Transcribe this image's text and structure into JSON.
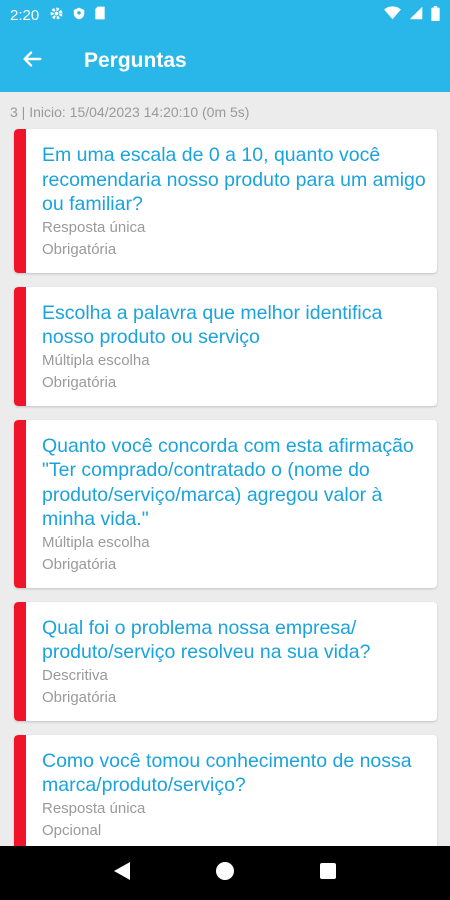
{
  "status_bar": {
    "time": "2:20",
    "icons_left": [
      "gear-icon",
      "shield-icon",
      "sd-card-icon"
    ],
    "icons_right": [
      "wifi-icon",
      "signal-icon",
      "battery-icon"
    ]
  },
  "app_bar": {
    "title": "Perguntas",
    "back_icon": "arrow-back-icon",
    "color": "#29b6e8"
  },
  "info_line": "3 | Inicio: 15/04/2023 14:20:10 (0m 5s)",
  "questions": [
    {
      "text": "Em uma escala de 0 a 10, quanto você recomendaria nosso produto para um amigo ou familiar?",
      "type": "Resposta única",
      "requirement": "Obrigatória"
    },
    {
      "text": "Escolha a palavra que melhor identifica nosso produto ou serviço",
      "type": "Múltipla escolha",
      "requirement": "Obrigatória"
    },
    {
      "text": "Quanto você concorda com esta afirmação \"Ter comprado/contratado o (nome do produto/serviço/marca) agregou valor à minha vida.\"",
      "type": "Múltipla escolha",
      "requirement": "Obrigatória"
    },
    {
      "text": "Qual foi o problema nossa empresa/ produto/serviço resolveu na sua vida?",
      "type": "Descritiva",
      "requirement": "Obrigatória"
    },
    {
      "text": "Como você tomou conhecimento de nossa marca/produto/serviço?",
      "type": "Resposta única",
      "requirement": "Opcional"
    }
  ],
  "colors": {
    "accent": "#29b6e8",
    "question_text": "#1aa3dc",
    "required_bar": "#f0142a"
  },
  "nav_bar": {
    "icons": [
      "back-triangle-icon",
      "home-circle-icon",
      "recents-square-icon"
    ]
  }
}
